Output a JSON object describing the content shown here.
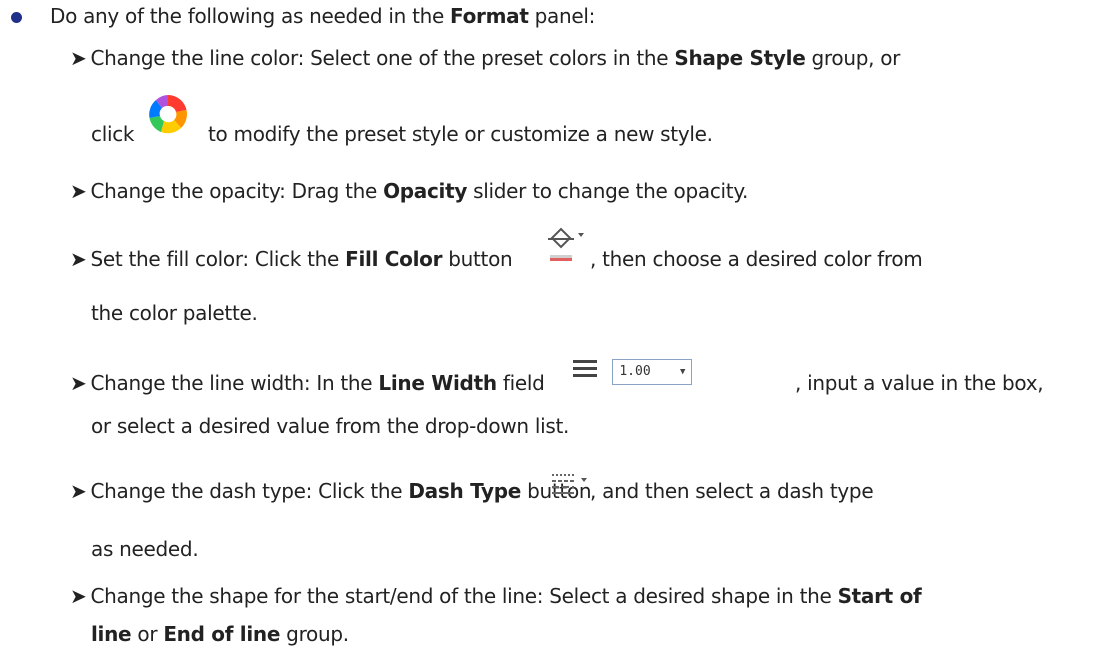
{
  "lines": {
    "intro": {
      "pre": "Do any of the following as needed in the ",
      "b1": "Format",
      "post": " panel:"
    },
    "color1": {
      "pre": "Change the line color: Select one of the preset colors in the ",
      "b1": "Shape Style",
      "post": " group, or"
    },
    "color2": {
      "pre": "click",
      "post": "to modify the preset style or customize a new style."
    },
    "opacity": {
      "pre": "Change the opacity: Drag the ",
      "b1": "Opacity",
      "post": " slider to change the opacity."
    },
    "fill1": {
      "pre": "Set the fill color: Click the ",
      "b1": "Fill Color",
      "mid": " button",
      "post": ", then choose a desired color from"
    },
    "fill2": {
      "text": "the color palette."
    },
    "width1": {
      "pre": "Change the line width: In the ",
      "b1": "Line Width",
      "mid": " field",
      "post": ", input a value in the box,"
    },
    "width2": {
      "text": "or select a desired value from the drop-down list."
    },
    "dash1": {
      "pre": "Change the dash type: Click the ",
      "b1": "Dash Type",
      "mid": " button",
      "post": ", and then select a dash type"
    },
    "dash2": {
      "text": "as needed."
    },
    "end1": {
      "pre": "Change the shape for the start/end of the line: Select a desired shape in the ",
      "b1": "Start of"
    },
    "end2": {
      "b1": "line",
      "mid": " or ",
      "b2": "End of line",
      "post": " group."
    }
  },
  "line_width_value": "1.00",
  "icons": [
    "color-wheel-icon",
    "fill-color-icon",
    "line-width-icon",
    "dash-type-icon",
    "bullet-arrow-icon"
  ]
}
